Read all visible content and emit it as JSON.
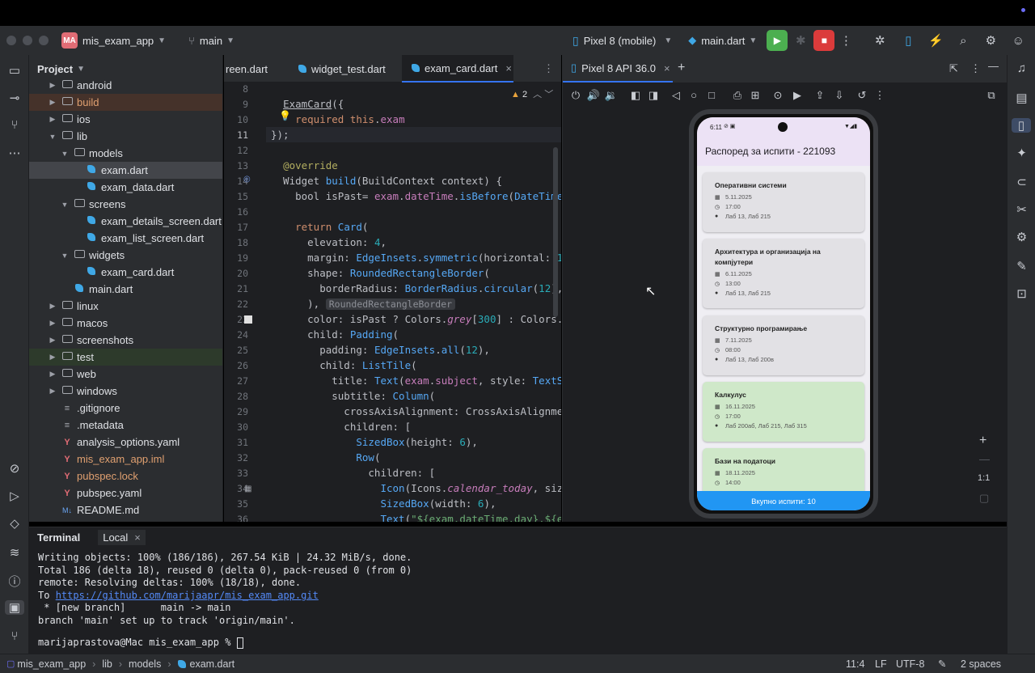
{
  "titlebar": {
    "project_badge": "MA",
    "project_name": "mis_exam_app",
    "branch": "main",
    "device": "Pixel 8 (mobile)",
    "run_config": "main.dart"
  },
  "project_panel": {
    "title": "Project",
    "items": [
      {
        "label": "android",
        "depth": 2,
        "type": "folder",
        "expanded": false
      },
      {
        "label": "build",
        "depth": 2,
        "type": "folder",
        "expanded": false
      },
      {
        "label": "ios",
        "depth": 2,
        "type": "folder",
        "expanded": false
      },
      {
        "label": "lib",
        "depth": 2,
        "type": "folder",
        "expanded": true
      },
      {
        "label": "models",
        "depth": 3,
        "type": "folder",
        "expanded": true
      },
      {
        "label": "exam.dart",
        "depth": 4,
        "type": "dart"
      },
      {
        "label": "exam_data.dart",
        "depth": 4,
        "type": "dart"
      },
      {
        "label": "screens",
        "depth": 3,
        "type": "folder",
        "expanded": true
      },
      {
        "label": "exam_details_screen.dart",
        "depth": 4,
        "type": "dart"
      },
      {
        "label": "exam_list_screen.dart",
        "depth": 4,
        "type": "dart"
      },
      {
        "label": "widgets",
        "depth": 3,
        "type": "folder",
        "expanded": true
      },
      {
        "label": "exam_card.dart",
        "depth": 4,
        "type": "dart"
      },
      {
        "label": "main.dart",
        "depth": 3,
        "type": "dart"
      },
      {
        "label": "linux",
        "depth": 2,
        "type": "folder",
        "expanded": false
      },
      {
        "label": "macos",
        "depth": 2,
        "type": "folder",
        "expanded": false
      },
      {
        "label": "screenshots",
        "depth": 2,
        "type": "folder",
        "expanded": false
      },
      {
        "label": "test",
        "depth": 2,
        "type": "folder",
        "expanded": false
      },
      {
        "label": "web",
        "depth": 2,
        "type": "folder",
        "expanded": false
      },
      {
        "label": "windows",
        "depth": 2,
        "type": "folder",
        "expanded": false
      },
      {
        "label": ".gitignore",
        "depth": 2,
        "type": "file"
      },
      {
        "label": ".metadata",
        "depth": 2,
        "type": "file"
      },
      {
        "label": "analysis_options.yaml",
        "depth": 2,
        "type": "yaml"
      },
      {
        "label": "mis_exam_app.iml",
        "depth": 2,
        "type": "iml"
      },
      {
        "label": "pubspec.lock",
        "depth": 2,
        "type": "lock"
      },
      {
        "label": "pubspec.yaml",
        "depth": 2,
        "type": "yaml"
      },
      {
        "label": "README.md",
        "depth": 2,
        "type": "md"
      }
    ]
  },
  "editor": {
    "tabs": [
      "reen.dart",
      "widget_test.dart",
      "exam_card.dart"
    ],
    "warnings": "2",
    "line_numbers": [
      "8",
      "9",
      "10",
      "11",
      "12",
      "13",
      "14",
      "15",
      "16",
      "17",
      "18",
      "19",
      "20",
      "21",
      "22",
      "23",
      "24",
      "25",
      "26",
      "27",
      "28",
      "29",
      "30",
      "31",
      "32",
      "33",
      "34",
      "35",
      "36"
    ]
  },
  "device_panel": {
    "tab": "Pixel 8 API 36.0"
  },
  "phone": {
    "time": "6:11",
    "app_title": "Распоред за испити - 221093",
    "cards": [
      {
        "title": "Оперативни системи",
        "date": "5.11.2025",
        "time": "17:00",
        "place": "Лаб 13, Лаб 215",
        "color": "#e2e1e5"
      },
      {
        "title": "Архитектура и организација на компјутери",
        "date": "6.11.2025",
        "time": "13:00",
        "place": "Лаб 13, Лаб 215",
        "color": "#e2e1e5"
      },
      {
        "title": "Структурно програмирање",
        "date": "7.11.2025",
        "time": "08:00",
        "place": "Лаб 13, Лаб 200в",
        "color": "#e2e1e5"
      },
      {
        "title": "Калкулус",
        "date": "16.11.2025",
        "time": "17:00",
        "place": "Лаб 200аб, Лаб 215, Лаб 315",
        "color": "#cfe8c9"
      },
      {
        "title": "Бази на податоци",
        "date": "18.11.2025",
        "time": "14:00",
        "place": "",
        "color": "#cfe8c9"
      }
    ],
    "footer": "Вкупно испити: 10"
  },
  "terminal": {
    "tab_title": "Terminal",
    "session": "Local",
    "lines": [
      "Writing objects: 100% (186/186), 267.54 KiB | 24.32 MiB/s, done.",
      "Total 186 (delta 18), reused 0 (delta 0), pack-reused 0 (from 0)",
      "remote: Resolving deltas: 100% (18/18), done."
    ],
    "to_prefix": "To ",
    "to_url": "https://github.com/marijaapr/mis_exam_app.git",
    "branch_line": " * [new branch]      main -> main",
    "track_line": "branch 'main' set up to track 'origin/main'.",
    "prompt": "marijaprastova@Mac mis_exam_app % "
  },
  "statusbar": {
    "crumbs": [
      "mis_exam_app",
      "lib",
      "models",
      "exam.dart"
    ],
    "position": "11:4",
    "line_sep": "LF",
    "encoding": "UTF-8",
    "indent": "2 spaces"
  }
}
